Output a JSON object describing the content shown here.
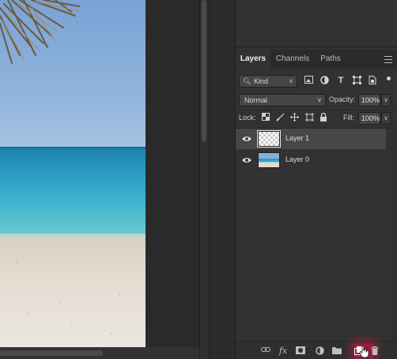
{
  "panel": {
    "tabs": [
      {
        "label": "Layers",
        "active": true
      },
      {
        "label": "Channels",
        "active": false
      },
      {
        "label": "Paths",
        "active": false
      }
    ],
    "filter": {
      "kind_label": "Kind",
      "icons": [
        "image-filter-icon",
        "adjustment-filter-icon",
        "type-filter-icon",
        "shape-filter-icon",
        "smart-object-filter-icon"
      ]
    },
    "blend": {
      "mode": "Normal",
      "opacity_label": "Opacity:",
      "opacity_value": "100%"
    },
    "lock": {
      "label": "Lock:",
      "fill_label": "Fill:",
      "fill_value": "100%"
    },
    "layers": [
      {
        "name": "Layer 1",
        "selected": true,
        "thumbnail": "transparent"
      },
      {
        "name": "Layer 0",
        "selected": false,
        "thumbnail": "photo"
      }
    ],
    "bottom_icons": [
      "link-layers-icon",
      "fx-icon",
      "add-mask-icon",
      "adjustment-layer-icon",
      "new-group-icon",
      "new-layer-icon",
      "delete-layer-icon"
    ],
    "fx_label": "fx"
  },
  "colors": {
    "panel_bg": "#323232",
    "selected_row": "#474747",
    "highlight": "#9c1c3a"
  }
}
